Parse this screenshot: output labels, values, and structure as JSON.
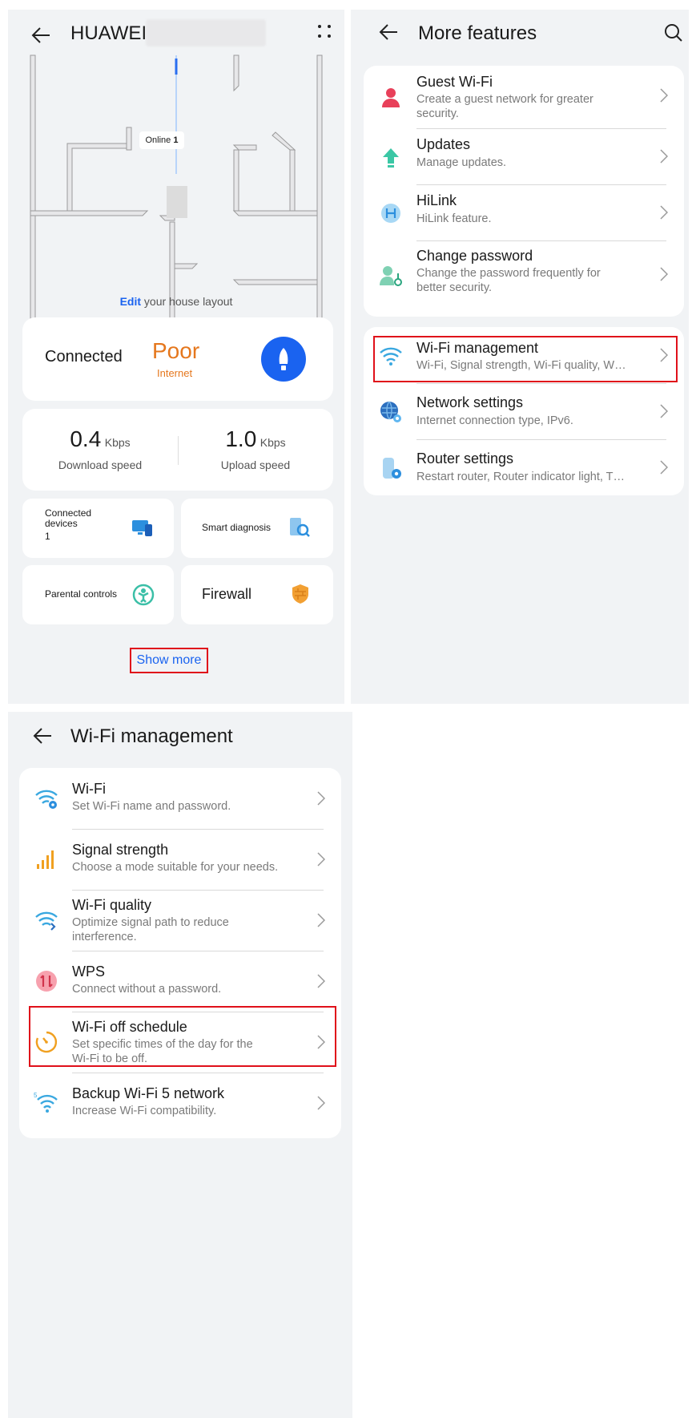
{
  "panel1": {
    "title": "HUAWEI",
    "map": {
      "online_label": "Online",
      "online_count": "1"
    },
    "edit_link": "Edit",
    "edit_suffix": " your house layout",
    "status": {
      "connected": "Connected",
      "quality": "Poor",
      "quality_sub": "Internet"
    },
    "speed": {
      "download_value": "0.4",
      "download_unit": "Kbps",
      "download_label": "Download speed",
      "upload_value": "1.0",
      "upload_unit": "Kbps",
      "upload_label": "Upload speed"
    },
    "tiles": {
      "connected_devices_l1": "Connected",
      "connected_devices_l2": "devices",
      "connected_devices_count": "1",
      "smart_diagnosis": "Smart diagnosis",
      "parental_controls": "Parental controls",
      "firewall": "Firewall"
    },
    "show_more": "Show more"
  },
  "panel2": {
    "title": "More features",
    "group1": [
      {
        "title": "Guest Wi-Fi",
        "sub1": "Create a guest network for greater",
        "sub2": "security.",
        "icon": "guest-user-icon"
      },
      {
        "title": "Updates",
        "sub1": "Manage updates.",
        "sub2": "",
        "icon": "update-arrow-icon"
      },
      {
        "title": "HiLink",
        "sub1": "HiLink feature.",
        "sub2": "",
        "icon": "hilink-icon"
      },
      {
        "title": "Change password",
        "sub1": "Change the password frequently for",
        "sub2": "better security.",
        "icon": "password-user-icon"
      }
    ],
    "group2": [
      {
        "title": "Wi-Fi management",
        "sub1": "Wi-Fi, Signal strength, Wi-Fi quality, W…",
        "icon": "wifi-icon"
      },
      {
        "title": "Network settings",
        "sub1": "Internet connection type, IPv6.",
        "icon": "globe-gear-icon"
      },
      {
        "title": "Router settings",
        "sub1": "Restart router, Router indicator light, T…",
        "icon": "router-gear-icon"
      }
    ]
  },
  "panel3": {
    "title": "Wi-Fi management",
    "items": [
      {
        "title": "Wi-Fi",
        "sub1": "Set Wi-Fi name and password.",
        "sub2": "",
        "icon": "wifi-gear-icon"
      },
      {
        "title": "Signal strength",
        "sub1": "Choose a mode suitable for your needs.",
        "sub2": "",
        "icon": "signal-bars-icon"
      },
      {
        "title": "Wi-Fi quality",
        "sub1": "Optimize signal path to reduce",
        "sub2": "interference.",
        "icon": "wifi-quality-icon"
      },
      {
        "title": "WPS",
        "sub1": "Connect without a password.",
        "sub2": "",
        "icon": "wps-icon"
      },
      {
        "title": "Wi-Fi off schedule",
        "sub1": "Set specific times of the day for the",
        "sub2": "Wi-Fi to be off.",
        "icon": "timer-icon"
      },
      {
        "title": "Backup Wi-Fi 5 network",
        "sub1": "Increase Wi-Fi compatibility.",
        "sub2": "",
        "icon": "wifi5-icon"
      }
    ]
  },
  "colors": {
    "accent": "#1a63f0",
    "poor": "#e5771d",
    "highlight": "#e0101a",
    "link": "#1a63f0"
  }
}
